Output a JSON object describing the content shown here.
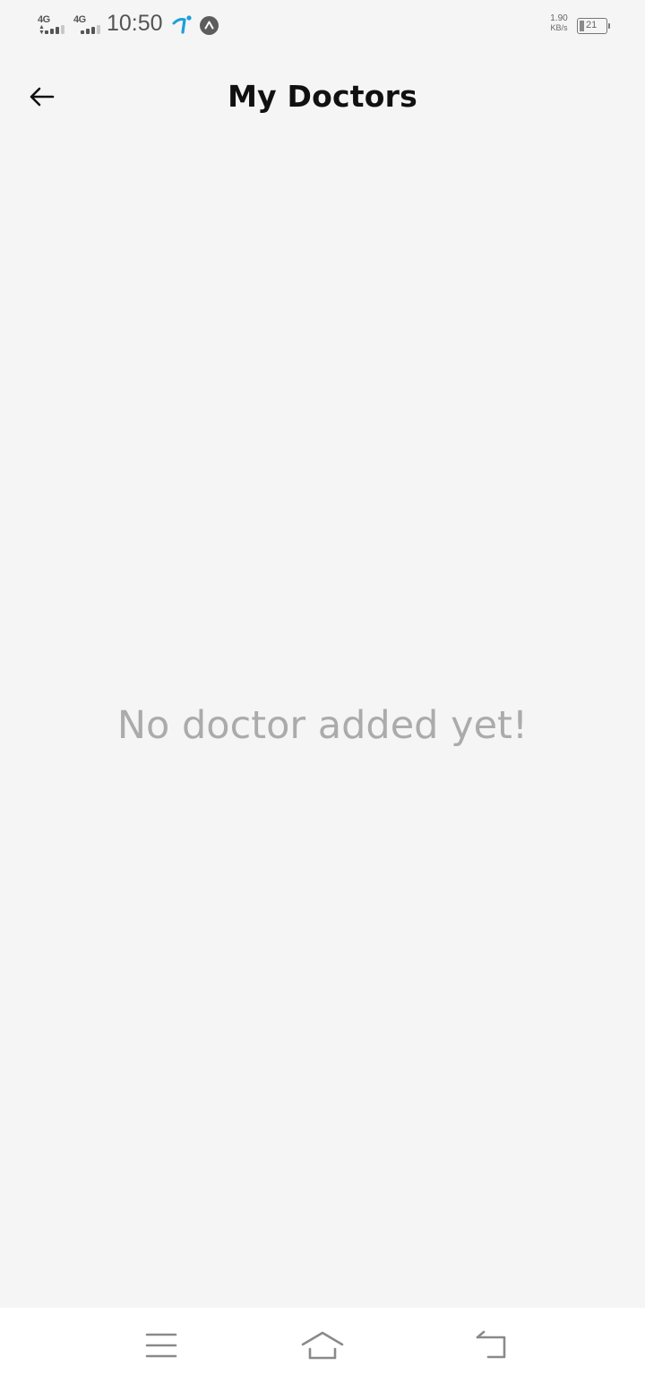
{
  "status_bar": {
    "sim1_network": "4G",
    "sim2_network": "4G",
    "time": "10:50",
    "net_speed_value": "1.90",
    "net_speed_unit": "KB/s",
    "battery_level": "21",
    "icons": [
      "signal-icon",
      "signal-icon",
      "carrier-icon",
      "app-notification-icon",
      "battery-icon"
    ]
  },
  "header": {
    "title": "My Doctors",
    "back_icon": "arrow-left-icon"
  },
  "main": {
    "empty_message": "No doctor added yet!"
  },
  "nav_bar": {
    "icons": [
      "menu-icon",
      "home-icon",
      "back-icon"
    ]
  },
  "colors": {
    "background": "#f5f5f5",
    "title": "#111111",
    "empty_text": "#ababab",
    "carrier_accent": "#1aa0dc"
  }
}
